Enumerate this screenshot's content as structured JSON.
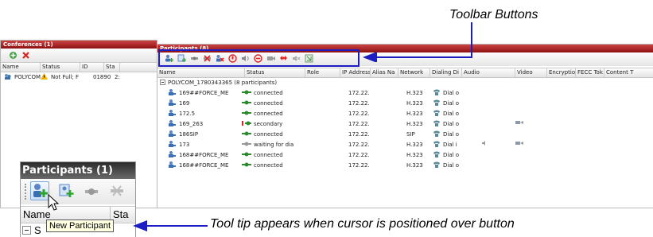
{
  "annotations": {
    "toolbar_buttons": "Toolbar Buttons",
    "tooltip_caption": "Tool tip appears when cursor is positioned over button"
  },
  "conferences_panel": {
    "title": "Conferences (1)",
    "columns": [
      "Name",
      "Status",
      "ID",
      "Sta"
    ],
    "row": {
      "name": "POLYCOM",
      "status": "Not Full; F",
      "id": "01890",
      "sta": "2:"
    }
  },
  "participants_panel": {
    "title": "Participants (8)",
    "columns": [
      "Name",
      "Status",
      "Role",
      "IP Address",
      "Alias Na",
      "Network",
      "Dialing Di",
      "Audio",
      "Video",
      "Encryptio",
      "FECC Tok",
      "Content T"
    ],
    "group_row": "POLYCOM_1780343365 (8 participants)",
    "rows": [
      {
        "name": "169##FORCE_ME",
        "status": "connected",
        "ip": "172.22.",
        "network": "H.323",
        "dialing": "Dial o",
        "audio": "",
        "video": ""
      },
      {
        "name": "169",
        "status": "connected",
        "ip": "172.22.",
        "network": "H.323",
        "dialing": "Dial o",
        "audio": "",
        "video": ""
      },
      {
        "name": "172.5",
        "status": "connected",
        "ip": "172.22.",
        "network": "H.323",
        "dialing": "Dial o",
        "audio": "",
        "video": ""
      },
      {
        "name": "169_263",
        "status": "secondary",
        "ip": "172.22.",
        "network": "H.323",
        "dialing": "Dial o",
        "audio": "",
        "video": "muted"
      },
      {
        "name": "186SIP",
        "status": "connected",
        "ip": "172.22.",
        "network": "SIP",
        "dialing": "Dial o",
        "audio": "",
        "video": ""
      },
      {
        "name": "173",
        "status": "waiting for dia",
        "ip": "172.22.",
        "network": "H.323",
        "dialing": "Dial i",
        "audio": "muted",
        "video": "muted"
      },
      {
        "name": "168##FORCE_ME",
        "status": "connected",
        "ip": "172.22.",
        "network": "H.323",
        "dialing": "Dial o",
        "audio": "",
        "video": ""
      },
      {
        "name": "168##FORCE_ME",
        "status": "connected",
        "ip": "172.22.",
        "network": "H.323",
        "dialing": "Dial o",
        "audio": "",
        "video": ""
      }
    ]
  },
  "zoom_inset": {
    "title": "Participants (1)",
    "header_name": "Name",
    "header_status": "Sta",
    "row_start": "S"
  },
  "tooltip": {
    "text": "New Participant"
  },
  "colors": {
    "title_red": "#8d1212",
    "highlight_box": "#1d1dc4",
    "arrow": "#1d1dc4"
  }
}
